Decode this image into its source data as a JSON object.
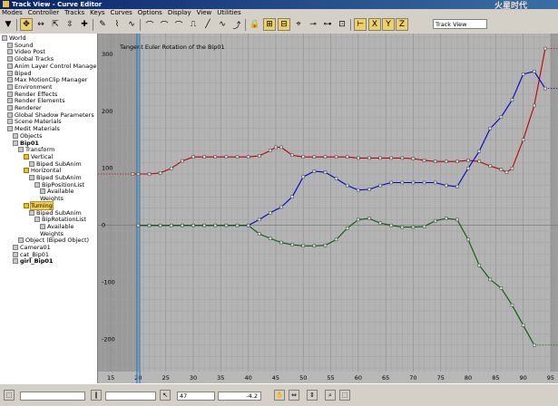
{
  "window": {
    "title": "Track View - Curve Editor",
    "watermark": "火星时代"
  },
  "menu": [
    "Modes",
    "Controller",
    "Tracks",
    "Keys",
    "Curves",
    "Options",
    "Display",
    "View",
    "Utilities"
  ],
  "toolbar": {
    "track_view_field": "Track View",
    "icons": [
      "filter-icon",
      "move-keys-icon",
      "slide-keys-icon",
      "scale-keys-icon",
      "scale-values-icon",
      "add-keys-icon",
      "draw-curves-icon",
      "reduce-keys-icon",
      "tangent-auto-icon",
      "tangent-custom-icon",
      "tangent-fast-icon",
      "tangent-slow-icon",
      "tangent-step-icon",
      "tangent-linear-icon",
      "tangent-smooth-icon",
      "parameter-curve-out-icon",
      "lock-selection-icon",
      "snap-frames-icon",
      "lock-tangents-icon",
      "show-tangents-icon",
      "break-tangents-icon",
      "unify-tangents-icon",
      "filter-keys-icon",
      "position-ranges-icon",
      "keys-x-icon",
      "keys-y-icon",
      "keys-z-icon"
    ]
  },
  "tree": [
    {
      "label": "World",
      "indent": 0,
      "icon": "world"
    },
    {
      "label": "Sound",
      "indent": 1,
      "icon": "sound"
    },
    {
      "label": "Video Post",
      "indent": 1,
      "icon": "item"
    },
    {
      "label": "Global Tracks",
      "indent": 1,
      "icon": "item"
    },
    {
      "label": "Anim Layer Control Manager",
      "indent": 1,
      "icon": "item"
    },
    {
      "label": "Biped",
      "indent": 1,
      "icon": "item"
    },
    {
      "label": "Max MotionClip Manager",
      "indent": 1,
      "icon": "item"
    },
    {
      "label": "Environment",
      "indent": 1,
      "icon": "item"
    },
    {
      "label": "Render Effects",
      "indent": 1,
      "icon": "item"
    },
    {
      "label": "Render Elements",
      "indent": 1,
      "icon": "item"
    },
    {
      "label": "Renderer",
      "indent": 1,
      "icon": "item"
    },
    {
      "label": "Global Shadow Parameters",
      "indent": 1,
      "icon": "item"
    },
    {
      "label": "Scene Materials",
      "indent": 1,
      "icon": "item"
    },
    {
      "label": "Medit Materials",
      "indent": 1,
      "icon": "item"
    },
    {
      "label": "Objects",
      "indent": 2,
      "icon": "item"
    },
    {
      "label": "Bip01",
      "indent": 2,
      "icon": "item",
      "bold": true
    },
    {
      "label": "Transform",
      "indent": 3,
      "icon": "item"
    },
    {
      "label": "Vertical",
      "indent": 4,
      "icon": "y"
    },
    {
      "label": "Biped SubAnim",
      "indent": 5,
      "icon": "item"
    },
    {
      "label": "Horizontal",
      "indent": 4,
      "icon": "y"
    },
    {
      "label": "Biped SubAnim",
      "indent": 5,
      "icon": "item"
    },
    {
      "label": "BipPositionList",
      "indent": 6,
      "icon": "item"
    },
    {
      "label": "Available",
      "indent": 7,
      "icon": "item"
    },
    {
      "label": "Weights",
      "indent": 7,
      "icon": "none"
    },
    {
      "label": "Turning",
      "indent": 4,
      "icon": "y",
      "selected": true
    },
    {
      "label": "Biped SubAnim",
      "indent": 5,
      "icon": "item"
    },
    {
      "label": "BipRotationList",
      "indent": 6,
      "icon": "item"
    },
    {
      "label": "Available",
      "indent": 7,
      "icon": "item"
    },
    {
      "label": "Weights",
      "indent": 7,
      "icon": "none"
    },
    {
      "label": "Object (Biped Object)",
      "indent": 3,
      "icon": "item"
    },
    {
      "label": "Camera01",
      "indent": 2,
      "icon": "item"
    },
    {
      "label": "cat_Bip01",
      "indent": 2,
      "icon": "item"
    },
    {
      "label": "girl_Bip01",
      "indent": 2,
      "icon": "item",
      "bold": true
    }
  ],
  "graph": {
    "curve_label": "Tangent Euler Rotation of the Bip01",
    "colors": {
      "x_curve": "#c00000",
      "y_curve": "#0000d0",
      "z_curve": "#006000",
      "bg_active": "#b4b4b4",
      "bg_inactive": "#9a9a9a",
      "timeslider": "#2a80c0"
    },
    "current_frame": 20,
    "active_range": [
      20,
      95
    ],
    "x_range": [
      13,
      96
    ],
    "y_range": [
      -250,
      330
    ],
    "x_ticks": [
      15,
      20,
      25,
      30,
      35,
      40,
      45,
      50,
      55,
      60,
      65,
      70,
      75,
      80,
      85,
      90,
      95
    ],
    "y_ticks": [
      300,
      200,
      100,
      0,
      -100,
      -200
    ],
    "series": [
      {
        "name": "",
        "color": "#c00000",
        "points": [
          [
            19,
            90
          ],
          [
            20,
            90
          ],
          [
            22,
            90
          ],
          [
            24,
            92
          ],
          [
            26,
            100
          ],
          [
            28,
            113
          ],
          [
            30,
            120
          ],
          [
            32,
            120
          ],
          [
            34,
            120
          ],
          [
            36,
            120
          ],
          [
            38,
            120
          ],
          [
            40,
            120
          ],
          [
            42,
            122
          ],
          [
            44,
            131
          ],
          [
            45,
            137
          ],
          [
            46,
            137
          ],
          [
            48,
            123
          ],
          [
            50,
            120
          ],
          [
            52,
            120
          ],
          [
            54,
            120
          ],
          [
            56,
            120
          ],
          [
            58,
            120
          ],
          [
            60,
            118
          ],
          [
            62,
            118
          ],
          [
            64,
            118
          ],
          [
            66,
            118
          ],
          [
            68,
            118
          ],
          [
            70,
            117
          ],
          [
            72,
            114
          ],
          [
            74,
            112
          ],
          [
            76,
            112
          ],
          [
            78,
            112
          ],
          [
            80,
            114
          ],
          [
            82,
            112
          ],
          [
            84,
            104
          ],
          [
            86,
            98
          ],
          [
            87,
            93
          ],
          [
            88,
            100
          ],
          [
            90,
            150
          ],
          [
            92,
            210
          ],
          [
            94,
            310
          ]
        ]
      },
      {
        "name": "",
        "color": "#0000d0",
        "points": [
          [
            20,
            0
          ],
          [
            22,
            0
          ],
          [
            24,
            0
          ],
          [
            26,
            0
          ],
          [
            28,
            0
          ],
          [
            30,
            0
          ],
          [
            32,
            0
          ],
          [
            34,
            0
          ],
          [
            36,
            0
          ],
          [
            38,
            0
          ],
          [
            40,
            0
          ],
          [
            42,
            10
          ],
          [
            44,
            22
          ],
          [
            46,
            32
          ],
          [
            48,
            50
          ],
          [
            50,
            85
          ],
          [
            52,
            95
          ],
          [
            54,
            93
          ],
          [
            56,
            82
          ],
          [
            58,
            70
          ],
          [
            60,
            62
          ],
          [
            62,
            63
          ],
          [
            64,
            70
          ],
          [
            66,
            75
          ],
          [
            68,
            75
          ],
          [
            70,
            75
          ],
          [
            72,
            75
          ],
          [
            74,
            75
          ],
          [
            76,
            70
          ],
          [
            78,
            68
          ],
          [
            80,
            100
          ],
          [
            82,
            130
          ],
          [
            84,
            170
          ],
          [
            86,
            190
          ],
          [
            88,
            220
          ],
          [
            90,
            265
          ],
          [
            92,
            270
          ],
          [
            94,
            240
          ]
        ]
      },
      {
        "name": "",
        "color": "#006000",
        "points": [
          [
            20,
            0
          ],
          [
            22,
            0
          ],
          [
            24,
            0
          ],
          [
            26,
            0
          ],
          [
            28,
            0
          ],
          [
            30,
            0
          ],
          [
            32,
            0
          ],
          [
            34,
            0
          ],
          [
            36,
            0
          ],
          [
            38,
            0
          ],
          [
            40,
            0
          ],
          [
            42,
            -15
          ],
          [
            44,
            -23
          ],
          [
            46,
            -30
          ],
          [
            48,
            -34
          ],
          [
            50,
            -36
          ],
          [
            52,
            -36
          ],
          [
            54,
            -35
          ],
          [
            56,
            -25
          ],
          [
            58,
            -5
          ],
          [
            60,
            10
          ],
          [
            62,
            12
          ],
          [
            64,
            4
          ],
          [
            66,
            0
          ],
          [
            68,
            -3
          ],
          [
            70,
            -3
          ],
          [
            72,
            -2
          ],
          [
            74,
            8
          ],
          [
            76,
            12
          ],
          [
            78,
            10
          ],
          [
            80,
            -25
          ],
          [
            82,
            -70
          ],
          [
            84,
            -95
          ],
          [
            86,
            -110
          ],
          [
            88,
            -140
          ],
          [
            90,
            -175
          ],
          [
            92,
            -210
          ]
        ]
      }
    ]
  },
  "status": {
    "frame_field": "47",
    "value_field": "-4.2",
    "tools": [
      "pan-icon",
      "zoom-horizontal-extents-icon",
      "zoom-value-extents-icon",
      "zoom-icon",
      "zoom-region-icon"
    ]
  }
}
